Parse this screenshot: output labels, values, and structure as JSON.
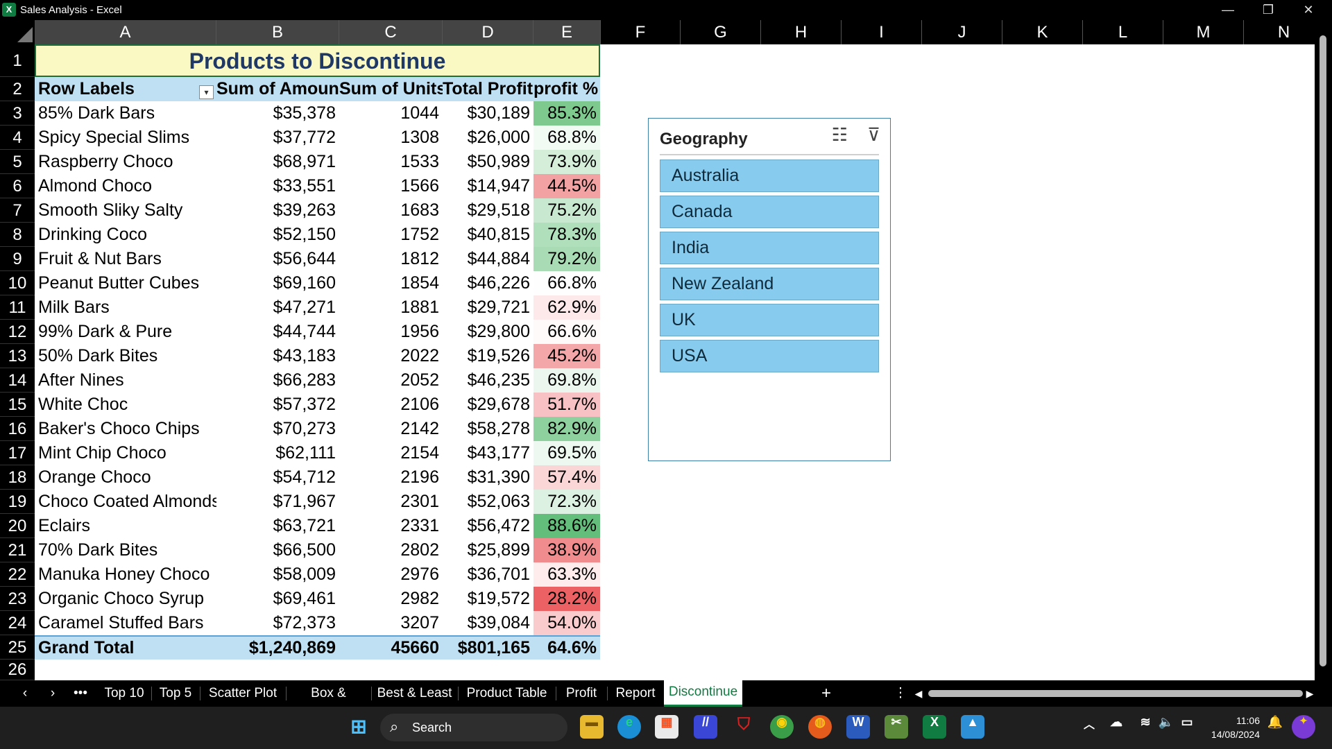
{
  "window": {
    "title": "Sales Analysis - Excel",
    "app_icon": "X",
    "controls": [
      "—",
      "❐",
      "✕"
    ]
  },
  "columns": [
    "A",
    "B",
    "C",
    "D",
    "E",
    "F",
    "G",
    "H",
    "I",
    "J",
    "K",
    "L",
    "M",
    "N"
  ],
  "pivot": {
    "title": "Products to Discontinue",
    "headers": [
      "Row Labels",
      "Sum of Amount",
      "Sum of Units",
      "Total Profit",
      "profit %"
    ],
    "rows": [
      {
        "product": "85% Dark Bars",
        "amount": "$35,378",
        "units": "1044",
        "profit": "$30,189",
        "pct": "85.3%",
        "color": "#7dc98e"
      },
      {
        "product": "Spicy Special Slims",
        "amount": "$37,772",
        "units": "1308",
        "profit": "$26,000",
        "pct": "68.8%",
        "color": "#f2faf4"
      },
      {
        "product": "Raspberry Choco",
        "amount": "$68,971",
        "units": "1533",
        "profit": "$50,989",
        "pct": "73.9%",
        "color": "#d4eeda"
      },
      {
        "product": "Almond Choco",
        "amount": "$33,551",
        "units": "1566",
        "profit": "$14,947",
        "pct": "44.5%",
        "color": "#f3a2a4"
      },
      {
        "product": "Smooth Sliky Salty",
        "amount": "$39,263",
        "units": "1683",
        "profit": "$29,518",
        "pct": "75.2%",
        "color": "#c8e9d0"
      },
      {
        "product": "Drinking Coco",
        "amount": "$52,150",
        "units": "1752",
        "profit": "$40,815",
        "pct": "78.3%",
        "color": "#b0dfbb"
      },
      {
        "product": "Fruit & Nut Bars",
        "amount": "$56,644",
        "units": "1812",
        "profit": "$44,884",
        "pct": "79.2%",
        "color": "#a9dcb5"
      },
      {
        "product": "Peanut Butter Cubes",
        "amount": "$69,160",
        "units": "1854",
        "profit": "$46,226",
        "pct": "66.8%",
        "color": "#fdfefd"
      },
      {
        "product": "Milk Bars",
        "amount": "$47,271",
        "units": "1881",
        "profit": "$29,721",
        "pct": "62.9%",
        "color": "#fde9ea"
      },
      {
        "product": "99% Dark & Pure",
        "amount": "$44,744",
        "units": "1956",
        "profit": "$29,800",
        "pct": "66.6%",
        "color": "#fffafa"
      },
      {
        "product": "50% Dark Bites",
        "amount": "$43,183",
        "units": "2022",
        "profit": "$19,526",
        "pct": "45.2%",
        "color": "#f4a7a9"
      },
      {
        "product": "After Nines",
        "amount": "$66,283",
        "units": "2052",
        "profit": "$46,235",
        "pct": "69.8%",
        "color": "#ebf7ee"
      },
      {
        "product": "White Choc",
        "amount": "$57,372",
        "units": "2106",
        "profit": "$29,678",
        "pct": "51.7%",
        "color": "#f8c1c3"
      },
      {
        "product": "Baker's Choco Chips",
        "amount": "$70,273",
        "units": "2142",
        "profit": "$58,278",
        "pct": "82.9%",
        "color": "#8fd19e"
      },
      {
        "product": "Mint Chip Choco",
        "amount": "$62,111",
        "units": "2154",
        "profit": "$43,177",
        "pct": "69.5%",
        "color": "#edf8f0"
      },
      {
        "product": "Orange Choco",
        "amount": "$54,712",
        "units": "2196",
        "profit": "$31,390",
        "pct": "57.4%",
        "color": "#fbd6d7"
      },
      {
        "product": "Choco Coated Almonds",
        "amount": "$71,967",
        "units": "2301",
        "profit": "$52,063",
        "pct": "72.3%",
        "color": "#dcf1e1"
      },
      {
        "product": "Eclairs",
        "amount": "$63,721",
        "units": "2331",
        "profit": "$56,472",
        "pct": "88.6%",
        "color": "#63be7b"
      },
      {
        "product": "70% Dark Bites",
        "amount": "$66,500",
        "units": "2802",
        "profit": "$25,899",
        "pct": "38.9%",
        "color": "#f18c8e"
      },
      {
        "product": "Manuka Honey Choco",
        "amount": "$58,009",
        "units": "2976",
        "profit": "$36,701",
        "pct": "63.3%",
        "color": "#feebec"
      },
      {
        "product": "Organic Choco Syrup",
        "amount": "$69,461",
        "units": "2982",
        "profit": "$19,572",
        "pct": "28.2%",
        "color": "#ec6163"
      },
      {
        "product": "Caramel Stuffed Bars",
        "amount": "$72,373",
        "units": "3207",
        "profit": "$39,084",
        "pct": "54.0%",
        "color": "#facbcc"
      }
    ],
    "total": {
      "label": "Grand Total",
      "amount": "$1,240,869",
      "units": "45660",
      "profit": "$801,165",
      "pct": "64.6%"
    }
  },
  "slicer": {
    "title": "Geography",
    "items": [
      "Australia",
      "Canada",
      "India",
      "New Zealand",
      "UK",
      "USA"
    ]
  },
  "sheet_tabs": {
    "tabs": [
      "Top 10",
      "Top 5",
      "Scatter Plot",
      "Box & Whiskers",
      "Best & Least",
      "Product Table",
      "Profit",
      "Report",
      "Discontinue"
    ],
    "active": "Discontinue",
    "add": "+",
    "more": "•••"
  },
  "taskbar": {
    "search_placeholder": "Search",
    "time": "11:06",
    "date": "14/08/2024"
  }
}
